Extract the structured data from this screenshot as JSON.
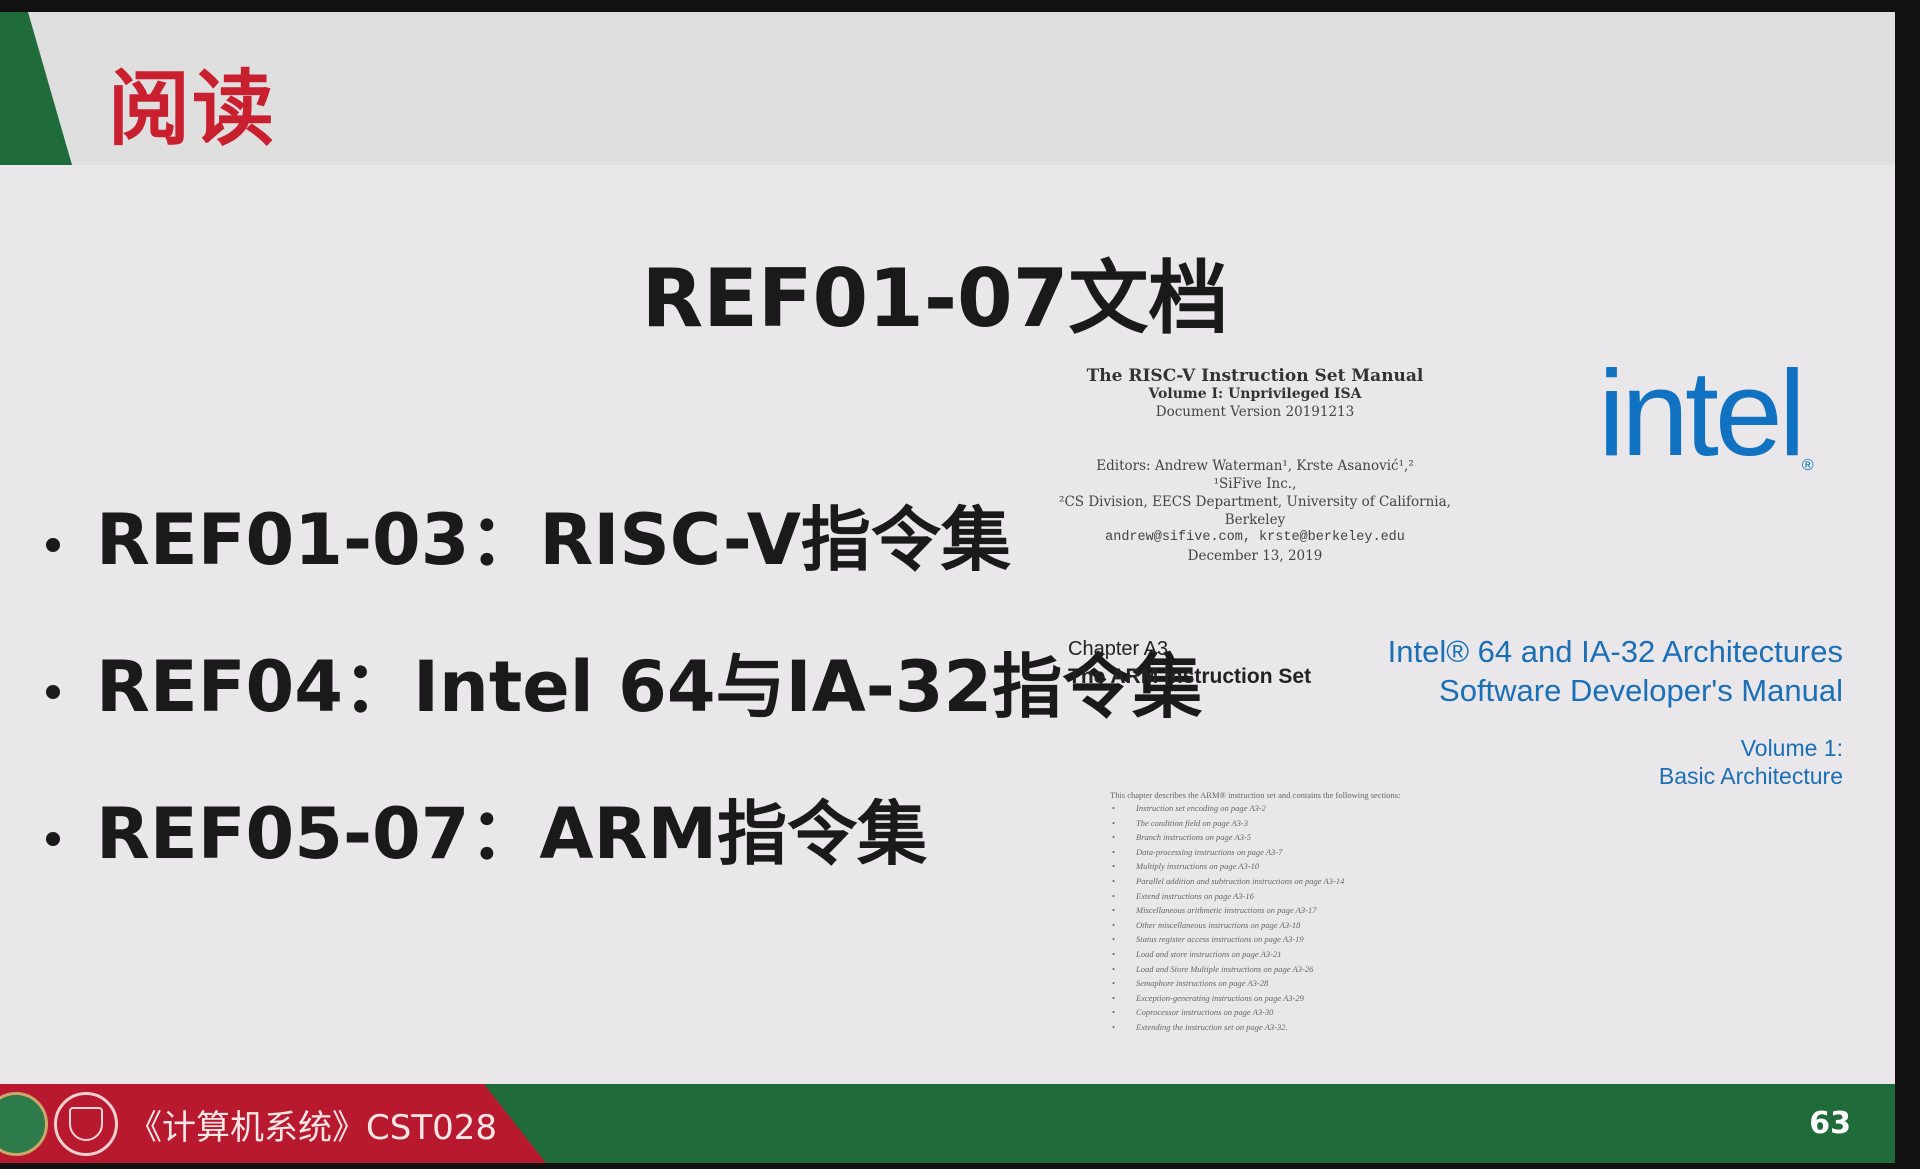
{
  "header": {
    "title": "阅读"
  },
  "main": {
    "subtitle": "REF01-07文档",
    "bullets": [
      "REF01-03：RISC-V指令集",
      "REF04：Intel 64与IA-32指令集",
      "REF05-07：ARM指令集"
    ]
  },
  "riscv_cover": {
    "title": "The RISC-V Instruction Set Manual",
    "volume": "Volume I: Unprivileged ISA",
    "version": "Document Version 20191213",
    "editors": "Editors: Andrew Waterman¹, Krste Asanović¹,²",
    "affil1": "¹SiFive Inc.,",
    "affil2": "²CS Division, EECS Department, University of California, Berkeley",
    "emails": "andrew@sifive.com, krste@berkeley.edu",
    "date": "December 13, 2019"
  },
  "intel_cover": {
    "logo": "intel",
    "title_line1": "Intel® 64 and IA-32 Architectures",
    "title_line2": "Software Developer's Manual",
    "volume_line1": "Volume 1:",
    "volume_line2": "Basic Architecture"
  },
  "arm_cover": {
    "chapter": "Chapter A3",
    "name": "The ARM Instruction Set",
    "intro": "This chapter describes the ARM® instruction set and contains the following sections:",
    "items": [
      "Instruction set encoding on page A3-2",
      "The condition field on page A3-3",
      "Branch instructions on page A3-5",
      "Data-processing instructions on page A3-7",
      "Multiply instructions on page A3-10",
      "Parallel addition and subtraction instructions on page A3-14",
      "Extend instructions on page A3-16",
      "Miscellaneous arithmetic instructions on page A3-17",
      "Other miscellaneous instructions on page A3-18",
      "Status register access instructions on page A3-19",
      "Load and store instructions on page A3-21",
      "Load and Store Multiple instructions on page A3-26",
      "Semaphore instructions on page A3-28",
      "Exception-generating instructions on page A3-29",
      "Coprocessor instructions on page A3-30",
      "Extending the instruction set on page A3-32."
    ]
  },
  "footer": {
    "course": "《计算机系统》CST028",
    "page_number": "63"
  },
  "colors": {
    "accent_red": "#b8192e",
    "accent_green": "#1f6b3a",
    "intel_blue": "#1072c0"
  }
}
